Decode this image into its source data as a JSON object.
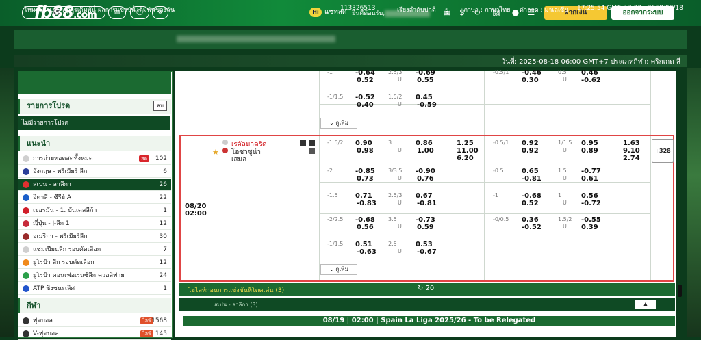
{
  "header": {
    "logo_main": "fb88",
    "logo_domain": ".com",
    "chat_badge": "Hi",
    "chat_label": "แชทสด",
    "welcome": "ยินดีต้อนรับ,",
    "deposit": "ฝากเงิน",
    "logout": "ออกจากระบบ"
  },
  "nav": {
    "items": [
      "โหมดยุโรป",
      "กฎการเดิมพัน",
      "ผลการแข่งขัน",
      "เดิมพันของฉัน"
    ],
    "account_id": "113326513",
    "sort": "เรียงลำดับปกติ",
    "odds_sep": "ยู",
    "language": "ภาษา : ภาษาไทย",
    "odds_type": "ค่าออด : มาเลเซีย",
    "time": "17:25:54 GMT +7:00",
    "date": "2568/08/18"
  },
  "date_strip": "วันที่: 2025-08-18 06:00 GMT+7 ประเภทกีฬา: คริกเกต ลี",
  "sidebar": {
    "sport_tab": "กีฬา",
    "fav_title": "รายการโปรด",
    "fav_delete": "ลบ",
    "no_fav": "ไม่มีรายการโปรด",
    "recommended_title": "แนะนำ",
    "leagues": [
      {
        "name": "การถ่ายทอดสดทั้งหมด",
        "count": "102",
        "badge": "สด",
        "color": "#cfcfcf"
      },
      {
        "name": "อังกฤษ - พรีเมียร์ ลีก",
        "count": "6",
        "badge": "",
        "color": "#2b3f9a"
      },
      {
        "name": "สเปน - ลาลีกา",
        "count": "26",
        "badge": "",
        "color": "#e03030"
      },
      {
        "name": "อิตาลี - ซีรีย์ A",
        "count": "22",
        "badge": "",
        "color": "#1b5fc9"
      },
      {
        "name": "เยอรมัน - 1. บันเดสลีก้า",
        "count": "1",
        "badge": "",
        "color": "#d11f2a"
      },
      {
        "name": "ญี่ปุ่น - J-ลีก 1",
        "count": "12",
        "badge": "",
        "color": "#c72a3a"
      },
      {
        "name": "อเมริกา - พรีเมียร์ลีก",
        "count": "30",
        "badge": "",
        "color": "#9a2b2b"
      },
      {
        "name": "แชมเปียนลีก รอบคัดเลือก",
        "count": "7",
        "badge": "",
        "color": "#cfcfcf"
      },
      {
        "name": "ยูโรป้า ลีก รอบคัดเลือก",
        "count": "12",
        "badge": "",
        "color": "#f08a1c"
      },
      {
        "name": "ยูโรป้า คอนเฟอเรนซ์ลีก ควอลิฟาย",
        "count": "24",
        "badge": "",
        "color": "#2ba04a"
      },
      {
        "name": "ATP ชิงชนะเลิศ",
        "count": "1",
        "badge": "",
        "color": "#2255cc"
      }
    ],
    "sports_title": "กีฬา",
    "sports": [
      {
        "name": "ฟุตบอล",
        "count": "1568",
        "badge": "ไลฟ์"
      },
      {
        "name": "V-ฟุตบอล",
        "count": "145",
        "badge": "ไลฟ์"
      }
    ]
  },
  "prev_match": {
    "rows": [
      {
        "hdp": "-1",
        "a": "-0.64",
        "b": "0.52",
        "ou": "2.5/3",
        "u": "U",
        "c": "-0.69",
        "d": "0.55",
        "hdp2": "-0.5/1",
        "e": "-0.46",
        "f": "0.30",
        "ou2": "0.5",
        "u2": "U",
        "g": "0.46",
        "h": "-0.62"
      },
      {
        "hdp": "-1/1.5",
        "a": "-0.52",
        "b": "0.40",
        "ou": "1.5/2",
        "u": "U",
        "c": "0.45",
        "d": "-0.59"
      }
    ],
    "more": "ดูเพิ่ม"
  },
  "match": {
    "date": "08/20",
    "time": "02:00",
    "home": "เรอัลมาดริด",
    "away": "โอซาซูน่า",
    "draw": "เสมอ",
    "more_count": "+328",
    "x12": [
      "1.25",
      "11.00",
      "6.20"
    ],
    "x12_ht": [
      "1.63",
      "9.10",
      "2.74"
    ],
    "rows": [
      {
        "hdp": "-1.5/2",
        "a": "0.90",
        "b": "0.98",
        "ou": "3",
        "u": "U",
        "c": "0.86",
        "d": "1.00",
        "hdp2": "-0.5/1",
        "e": "0.92",
        "f": "0.92",
        "ou2": "1/1.5",
        "u2": "U",
        "g": "0.95",
        "h": "0.89"
      },
      {
        "hdp": "-2",
        "a": "-0.85",
        "b": "0.73",
        "ou": "3/3.5",
        "u": "U",
        "c": "-0.90",
        "d": "0.76",
        "hdp2": "-0.5",
        "e": "0.65",
        "f": "-0.81",
        "ou2": "1.5",
        "u2": "U",
        "g": "-0.77",
        "h": "0.61"
      },
      {
        "hdp": "-1.5",
        "a": "0.71",
        "b": "-0.83",
        "ou": "2.5/3",
        "u": "U",
        "c": "0.67",
        "d": "-0.81",
        "hdp2": "-1",
        "e": "-0.68",
        "f": "0.52",
        "ou2": "1",
        "u2": "U",
        "g": "0.56",
        "h": "-0.72"
      },
      {
        "hdp": "-2/2.5",
        "a": "-0.68",
        "b": "0.56",
        "ou": "3.5",
        "u": "U",
        "c": "-0.73",
        "d": "0.59",
        "hdp2": "-0/0.5",
        "e": "0.36",
        "f": "-0.52",
        "ou2": "1.5/2",
        "u2": "U",
        "g": "-0.55",
        "h": "0.39"
      },
      {
        "hdp": "-1/1.5",
        "a": "0.51",
        "b": "-0.63",
        "ou": "2.5",
        "u": "U",
        "c": "0.53",
        "d": "-0.67"
      }
    ],
    "more": "ดูเพิ่ม"
  },
  "highlight_bar": "ไฮไลท์ก่อนการแข่งขันที่โดดเด่น (3)",
  "refresh_count": "20",
  "league_bar": "สเปน - ลาลีกา (3)",
  "card_title": "08/19 | 02:00 | Spain La Liga 2025/26 - To be Relegated"
}
